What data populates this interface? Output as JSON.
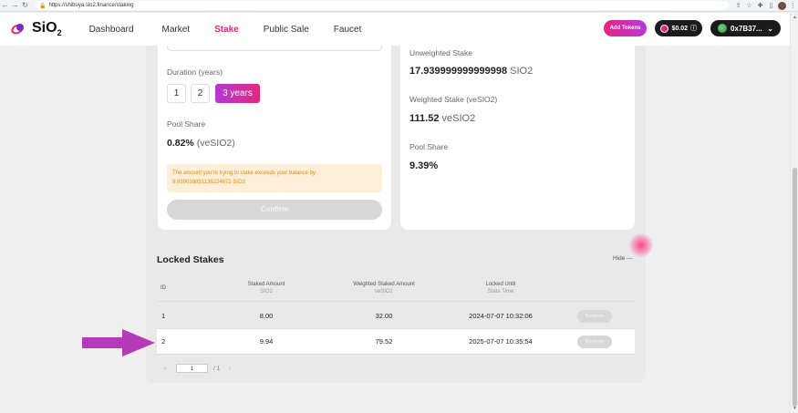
{
  "browser": {
    "url": "https://shibuya.sio2.finance/staking",
    "profile_initial": "M"
  },
  "header": {
    "logo_text": "SiO",
    "logo_sub": "2",
    "nav": [
      "Dashboard",
      "Market",
      "Stake",
      "Public Sale",
      "Faucet"
    ],
    "active_nav": "Stake",
    "add_tokens_label": "Add Tokens",
    "price_label": "$0.02",
    "wallet_label": "0x7B37..."
  },
  "stake_form": {
    "duration_label": "Duration (years)",
    "duration_options": [
      "1",
      "2",
      "3 years"
    ],
    "selected_duration": "3 years",
    "pool_share_label": "Pool Share",
    "pool_share_value": "0.82%",
    "pool_share_unit": "(veSIO2)",
    "warning_line1": "The amount you're trying to stake exceeds your balance by",
    "warning_line2": "9.939038831136224672 SIO2",
    "confirm_label": "Confirm"
  },
  "summary": {
    "unweighted_label": "Unweighted Stake",
    "unweighted_value": "17.939999999999998",
    "unweighted_unit": "SIO2",
    "weighted_label": "Weighted Stake (veSIO2)",
    "weighted_value": "111.52",
    "weighted_unit": "veSIO2",
    "pool_share_label": "Pool Share",
    "pool_share_value": "9.39%"
  },
  "locked_stakes": {
    "title": "Locked Stakes",
    "hide_label": "Hide —",
    "columns": [
      {
        "label": "ID",
        "sub": ""
      },
      {
        "label": "Staked Amount",
        "sub": "SIO2"
      },
      {
        "label": "Weighted Staked Amount",
        "sub": "veSIO2"
      },
      {
        "label": "Locked Until",
        "sub": "State Time"
      }
    ],
    "rows": [
      {
        "id": "1",
        "staked": "8.00",
        "weighted": "32.00",
        "until": "2024-07-07 10:32:06",
        "action": "Redeem"
      },
      {
        "id": "2",
        "staked": "9.94",
        "weighted": "79.52",
        "until": "2025-07-07 10:35:54",
        "action": "Redeem"
      }
    ],
    "page_value": "1",
    "page_total": "/ 1"
  },
  "colors": {
    "accent": "#e4267f",
    "accent2": "#b33ad6",
    "warning_text": "#e28a16",
    "warning_bg": "#fdefd9",
    "annotation_arrow": "#b53ab8"
  }
}
